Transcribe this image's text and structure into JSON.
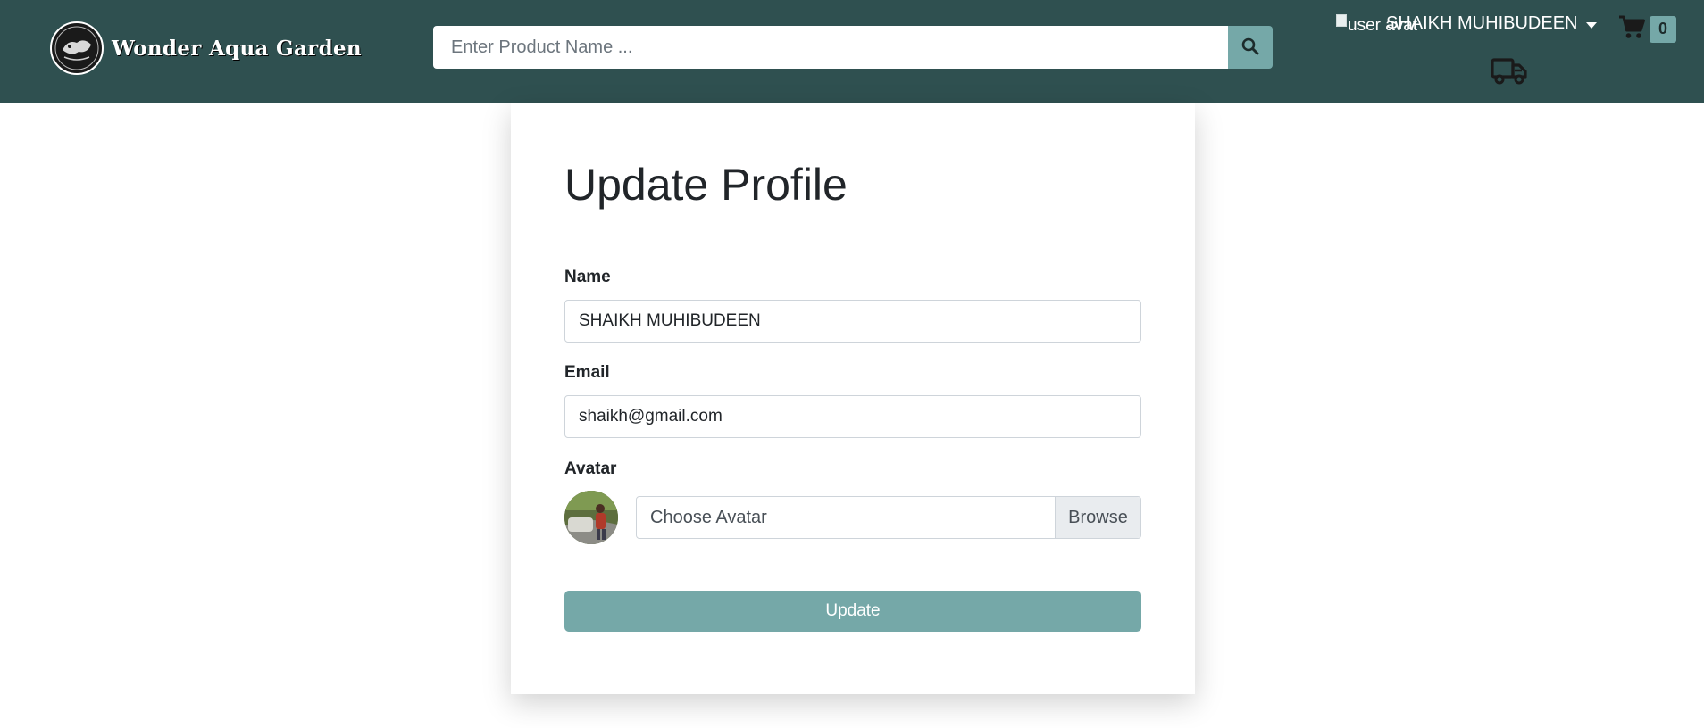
{
  "header": {
    "brand_name": "Wonder Aqua Garden",
    "search": {
      "placeholder": "Enter Product Name ..."
    },
    "user": {
      "avatar_alt": "user avat",
      "name": "SHAIKH MUHIBUDEEN"
    },
    "cart": {
      "count": "0"
    },
    "icons": {
      "search": "search-icon",
      "cart": "shopping-cart-icon",
      "dropdown": "caret-down-icon",
      "orders": "truck-icon"
    },
    "colors": {
      "navbar": "#2f5050",
      "accent": "#75a8a8"
    }
  },
  "form": {
    "title": "Update Profile",
    "name_label": "Name",
    "name_value": "SHAIKH MUHIBUDEEN",
    "email_label": "Email",
    "email_value": "shaikh@gmail.com",
    "avatar_label": "Avatar",
    "avatar_choose": "Choose Avatar",
    "browse_label": "Browse",
    "submit_label": "Update"
  }
}
